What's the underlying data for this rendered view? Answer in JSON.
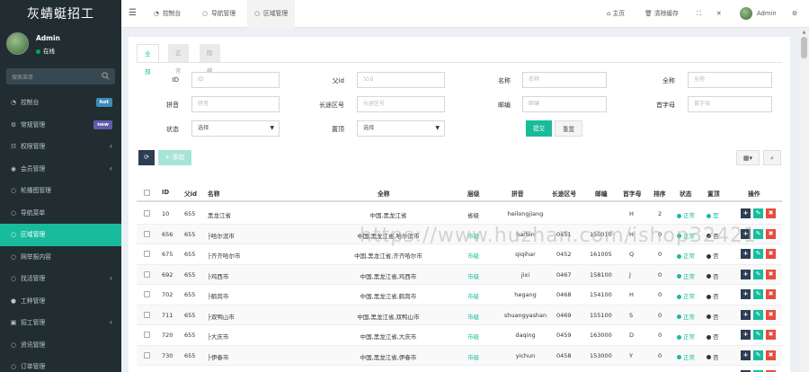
{
  "app": {
    "logo": "灰蜻蜓招工"
  },
  "user": {
    "name": "Admin",
    "status": "在线"
  },
  "sidebar": {
    "search_placeholder": "搜索菜单",
    "items": [
      {
        "label": "控制台",
        "icon": "dashboard-icon",
        "badge": "hot",
        "badge_color": "#3c8dbc"
      },
      {
        "label": "常规管理",
        "icon": "cogs-icon",
        "badge": "new",
        "badge_color": "#605ca8"
      },
      {
        "label": "权限管理",
        "icon": "group-icon",
        "caret": "‹"
      },
      {
        "label": "会员管理",
        "icon": "user-circle-icon",
        "caret": "‹"
      },
      {
        "label": "轮播图管理",
        "icon": "circle-icon"
      },
      {
        "label": "导航菜单",
        "icon": "circle-icon"
      },
      {
        "label": "区域管理",
        "icon": "circle-icon",
        "active": true
      },
      {
        "label": "网举报内容",
        "icon": "circle-icon"
      },
      {
        "label": "找活管理",
        "icon": "circle-icon",
        "caret": "‹"
      },
      {
        "label": "工种管理",
        "icon": "user-icon"
      },
      {
        "label": "招工管理",
        "icon": "briefcase-icon",
        "caret": "‹"
      },
      {
        "label": "资讯管理",
        "icon": "circle-icon"
      },
      {
        "label": "订单管理",
        "icon": "circle-icon"
      }
    ]
  },
  "topbar": {
    "tabs": [
      {
        "label": "控制台",
        "icon": "dashboard-icon"
      },
      {
        "label": "导航管理",
        "icon": "circle-icon"
      },
      {
        "label": "区域管理",
        "icon": "circle-icon",
        "active": true
      }
    ],
    "right": {
      "home": "主页",
      "clear_cache": "清除缓存",
      "admin": "Admin"
    }
  },
  "subtabs": [
    "全部",
    "正常",
    "隐藏"
  ],
  "filters": {
    "id": {
      "label": "ID",
      "placeholder": "ID"
    },
    "pid": {
      "label": "父id",
      "placeholder": "父id"
    },
    "name": {
      "label": "名称",
      "placeholder": "名称"
    },
    "fullname": {
      "label": "全称",
      "placeholder": "全称"
    },
    "pinyin": {
      "label": "拼音",
      "placeholder": "拼音"
    },
    "citycode": {
      "label": "长途区号",
      "placeholder": "长途区号"
    },
    "zipcode": {
      "label": "邮编",
      "placeholder": "邮编"
    },
    "first": {
      "label": "首字母",
      "placeholder": "首字母"
    },
    "status": {
      "label": "状态",
      "value": "选择"
    },
    "top": {
      "label": "置顶",
      "value": "选择"
    },
    "submit": "提交",
    "reset": "重置"
  },
  "toolbar": {
    "refresh": "⟳",
    "add": "添加",
    "columns": "▦▾",
    "search": "⌕"
  },
  "table": {
    "headers": [
      "ID",
      "父id",
      "名称",
      "全称",
      "层级",
      "拼音",
      "长途区号",
      "邮编",
      "首字母",
      "排序",
      "状态",
      "置顶",
      "操作"
    ],
    "rows": [
      {
        "id": "10",
        "pid": "655",
        "name": "黑龙江省",
        "fullname": "中国,黑龙江省",
        "level": "省级",
        "pinyin": "heilongjiang",
        "citycode": "",
        "zipcode": "",
        "first": "H",
        "sort": "2",
        "status": "正常",
        "top": "是"
      },
      {
        "id": "656",
        "pid": "655",
        "name": "├哈尔滨市",
        "fullname": "中国,黑龙江省,哈尔滨市",
        "level": "市级",
        "pinyin": "harbin",
        "citycode": "0451",
        "zipcode": "150010",
        "first": "H",
        "sort": "0",
        "status": "正常",
        "top": "否"
      },
      {
        "id": "675",
        "pid": "655",
        "name": "├齐齐哈尔市",
        "fullname": "中国,黑龙江省,齐齐哈尔市",
        "level": "市级",
        "pinyin": "qiqihar",
        "citycode": "0452",
        "zipcode": "161005",
        "first": "Q",
        "sort": "0",
        "status": "正常",
        "top": "否"
      },
      {
        "id": "692",
        "pid": "655",
        "name": "├鸡西市",
        "fullname": "中国,黑龙江省,鸡西市",
        "level": "市级",
        "pinyin": "jixi",
        "citycode": "0467",
        "zipcode": "158100",
        "first": "J",
        "sort": "0",
        "status": "正常",
        "top": "否"
      },
      {
        "id": "702",
        "pid": "655",
        "name": "├鹤岗市",
        "fullname": "中国,黑龙江省,鹤岗市",
        "level": "市级",
        "pinyin": "hegang",
        "citycode": "0468",
        "zipcode": "154100",
        "first": "H",
        "sort": "0",
        "status": "正常",
        "top": "否"
      },
      {
        "id": "711",
        "pid": "655",
        "name": "├双鸭山市",
        "fullname": "中国,黑龙江省,双鸭山市",
        "level": "市级",
        "pinyin": "shuangyashan",
        "citycode": "0469",
        "zipcode": "155100",
        "first": "S",
        "sort": "0",
        "status": "正常",
        "top": "否"
      },
      {
        "id": "720",
        "pid": "655",
        "name": "├大庆市",
        "fullname": "中国,黑龙江省,大庆市",
        "level": "市级",
        "pinyin": "daqing",
        "citycode": "0459",
        "zipcode": "163000",
        "first": "D",
        "sort": "0",
        "status": "正常",
        "top": "否"
      },
      {
        "id": "730",
        "pid": "655",
        "name": "├伊春市",
        "fullname": "中国,黑龙江省,伊春市",
        "level": "市级",
        "pinyin": "yichun",
        "citycode": "0458",
        "zipcode": "153000",
        "first": "Y",
        "sort": "0",
        "status": "正常",
        "top": "否"
      },
      {
        "id": "748",
        "pid": "655",
        "name": "├佳木斯市",
        "fullname": "中国,黑龙江省,佳木斯市",
        "level": "市级",
        "pinyin": "jiamusi",
        "citycode": "0454",
        "zipcode": "154002",
        "first": "J",
        "sort": "0",
        "status": "正常",
        "top": "否"
      }
    ]
  },
  "watermark": "https://www.huzhan.com/ishop32421",
  "colors": {
    "accent": "#18bc9c",
    "sidebar": "#222d32",
    "dark": "#2c3e50",
    "danger": "#e74c3c"
  }
}
